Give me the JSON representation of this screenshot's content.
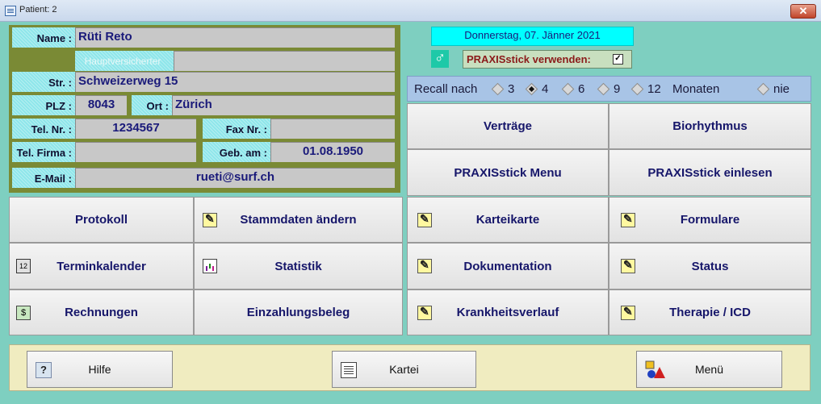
{
  "window": {
    "title": "Patient: 2",
    "close_label": "✕"
  },
  "patient": {
    "name_label": "Name :",
    "name": "Rüti Reto",
    "hauptversicherter_label": "Hauptversicherter",
    "hauptversicherter": "",
    "street_label": "Str. :",
    "street": "Schweizerweg 15",
    "plz_label": "PLZ :",
    "plz": "8043",
    "ort_label": "Ort :",
    "ort": "Zürich",
    "tel_label": "Tel. Nr. :",
    "tel": "1234567",
    "fax_label": "Fax Nr. :",
    "fax": "",
    "tel_firma_label": "Tel. Firma :",
    "tel_firma": "",
    "geb_label": "Geb. am :",
    "geb": "01.08.1950",
    "email_label": "E-Mail :",
    "email": "rueti@surf.ch"
  },
  "date": "Donnerstag, 07. Jänner 2021",
  "gender_icon": "♂",
  "praxis": {
    "label": "PRAXISstick verwenden:",
    "checked": true,
    "check_glyph": "✓"
  },
  "recall": {
    "prefix": "Recall nach",
    "options": [
      "3",
      "4",
      "6",
      "9",
      "12"
    ],
    "selected": "4",
    "suffix": "Monaten",
    "never": "nie"
  },
  "buttons": {
    "vertraege": "Verträge",
    "biorhythmus": "Biorhythmus",
    "praxis_menu": "PRAXISstick Menu",
    "praxis_einlesen": "PRAXISstick einlesen",
    "protokoll": "Protokoll",
    "stammdaten": "Stammdaten ändern",
    "karteikarte": "Karteikarte",
    "formulare": "Formulare",
    "terminkalender": "Terminkalender",
    "statistik": "Statistik",
    "dokumentation": "Dokumentation",
    "status": "Status",
    "rechnungen": "Rechnungen",
    "einzahlungsbeleg": "Einzahlungsbeleg",
    "krankheitsverlauf": "Krankheitsverlauf",
    "therapie": "Therapie / ICD"
  },
  "bottom": {
    "hilfe": "Hilfe",
    "kartei": "Kartei",
    "menu": "Menü"
  }
}
